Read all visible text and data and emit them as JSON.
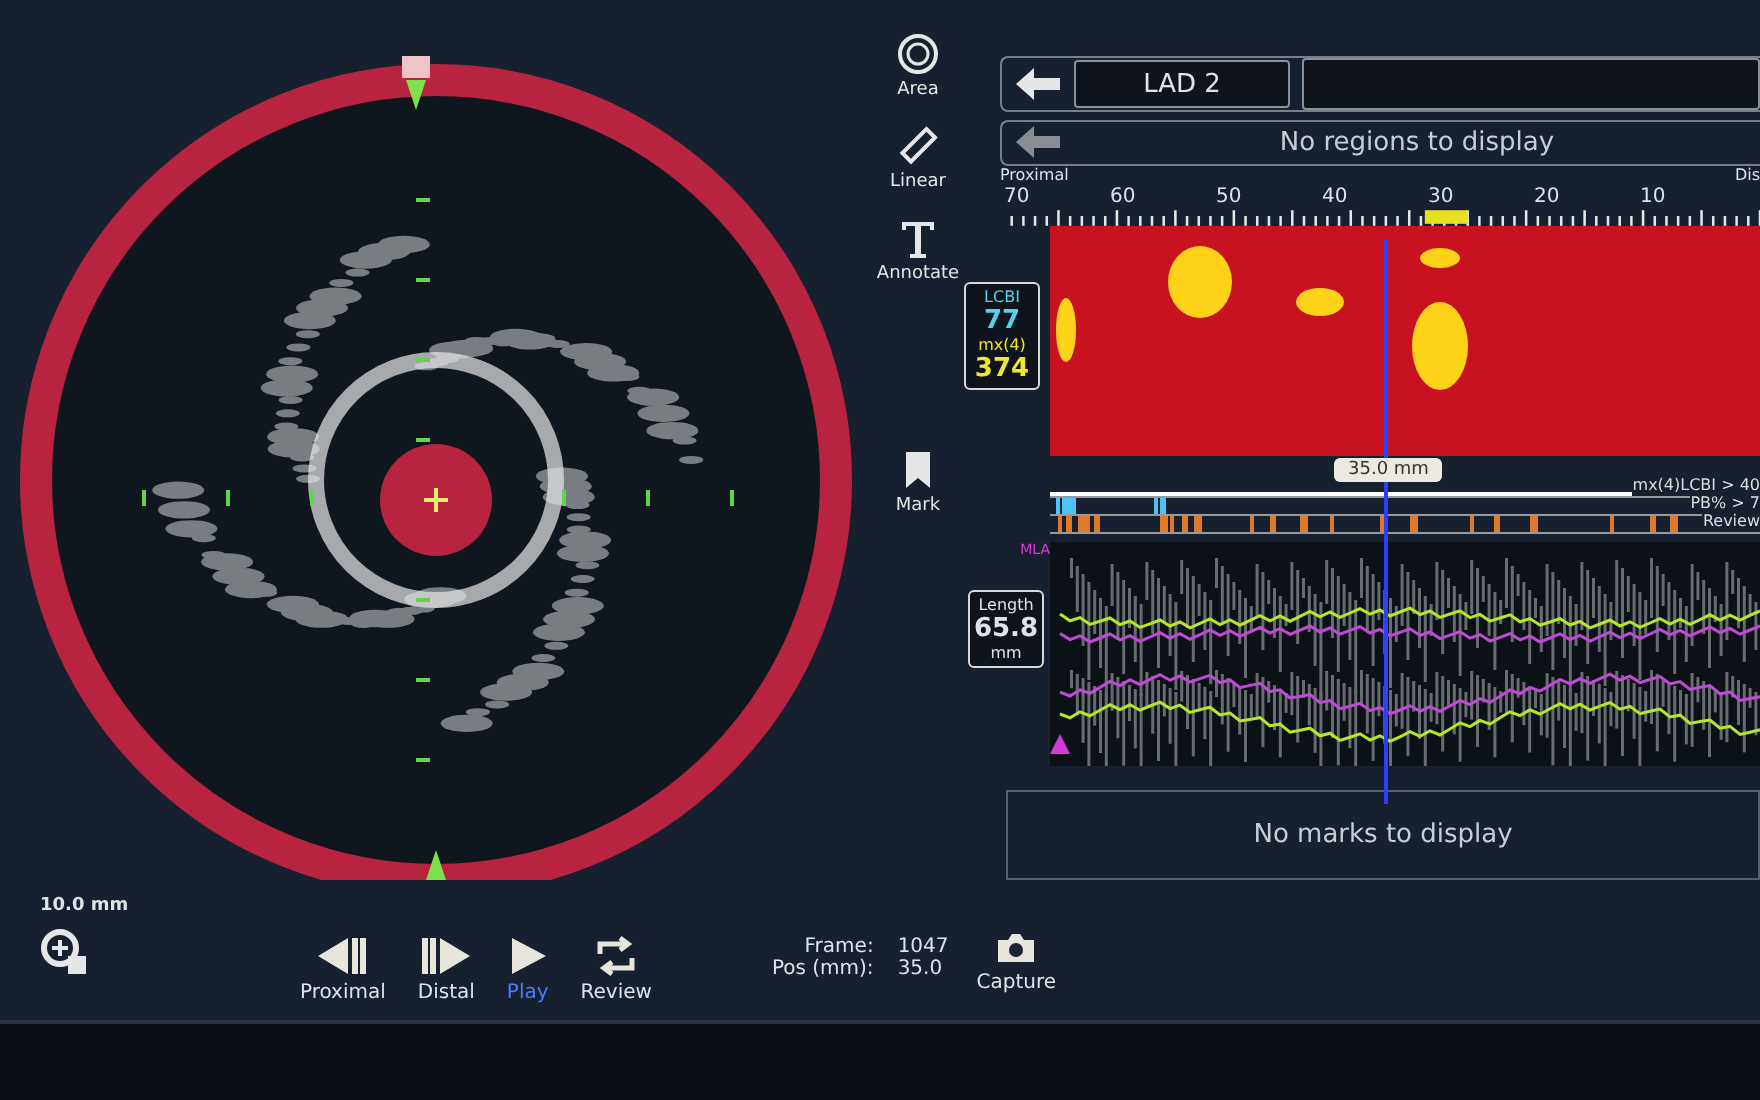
{
  "measurement_scale": "10.0 mm",
  "tools": [
    {
      "label": "Area",
      "kind": "area"
    },
    {
      "label": "Linear",
      "kind": "linear"
    },
    {
      "label": "Annotate",
      "kind": "annotate"
    },
    {
      "label": "Mark",
      "kind": "mark"
    }
  ],
  "vessel_tab": {
    "label": "LAD 2"
  },
  "regions_message": "No regions to display",
  "ruler": {
    "proximal_label": "Proximal",
    "distal_label": "Dis",
    "ticks": [
      "70",
      "60",
      "50",
      "40",
      "30",
      "20",
      "10"
    ]
  },
  "lcbi": {
    "label": "LCBI",
    "value": "77",
    "max_label": "mx(4)",
    "max_value": "374"
  },
  "position_tag": "35.0 mm",
  "tracks": [
    {
      "label": "mx(4)LCBI > 40",
      "color": "#ffffff"
    },
    {
      "label": "PB% > 7",
      "color": "#4fc3f7"
    },
    {
      "label": "Review",
      "color": "#e07a2a"
    }
  ],
  "mla_label": "MLA",
  "length": {
    "label": "Length",
    "value": "65.8",
    "unit": "mm"
  },
  "marks_message": "No marks to display",
  "playback": [
    {
      "label": "Proximal",
      "kind": "proximal",
      "selected": false
    },
    {
      "label": "Distal",
      "kind": "distal",
      "selected": false
    },
    {
      "label": "Play",
      "kind": "play",
      "selected": true
    },
    {
      "label": "Review",
      "kind": "review",
      "selected": false
    }
  ],
  "frame": {
    "label": "Frame:",
    "value": "1047"
  },
  "position": {
    "label": "Pos (mm):",
    "value": "35.0"
  },
  "capture": {
    "label": "Capture"
  }
}
